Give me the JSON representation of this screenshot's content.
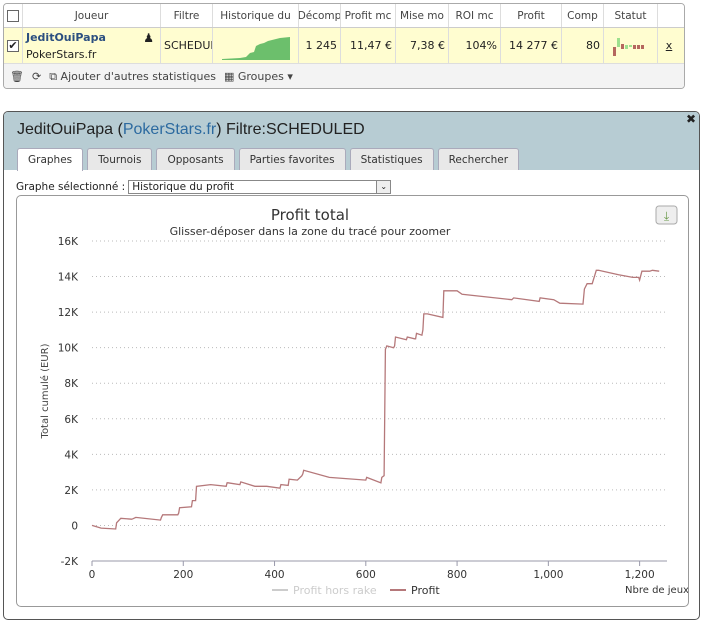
{
  "grid": {
    "headers": [
      "Joueur",
      "Filtre",
      "Historique du",
      "Décomp",
      "Profit mc",
      "Mise mo",
      "ROI mc",
      "Profit",
      "Comp",
      "Statut"
    ],
    "row": {
      "player": "JeditOuiPapa",
      "site": "PokerStars.fr",
      "filter": "SCHEDULED",
      "games": "1 245",
      "avg_profit": "11,47 €",
      "avg_stake": "7,38 €",
      "roi": "104%",
      "profit": "14 277 €",
      "comp": "80",
      "remove": "x"
    },
    "footer": {
      "add_stats": "Ajouter d'autres statistiques",
      "groups": "Groupes"
    }
  },
  "panel": {
    "title_player": "JeditOuiPapa",
    "title_open": " (",
    "title_site": "PokerStars.fr",
    "title_close": ")",
    "title_filter": " Filtre:SCHEDULED",
    "close": "✖",
    "tabs": [
      "Graphes",
      "Tournois",
      "Opposants",
      "Parties favorites",
      "Statistiques",
      "Rechercher"
    ],
    "select_label": "Graphe sélectionné :",
    "select_value": "Historique du profit"
  },
  "chart_data": {
    "type": "line",
    "title": "Profit total",
    "subtitle": "Glisser-déposer dans la zone du tracé pour zoomer",
    "xlabel": "Nbre de jeux",
    "ylabel": "Total cumulé (EUR)",
    "xlim": [
      0,
      1260
    ],
    "ylim": [
      -2000,
      16000
    ],
    "xticks": [
      0,
      200,
      400,
      600,
      800,
      1000,
      1200
    ],
    "xtick_labels": [
      "0",
      "200",
      "400",
      "600",
      "800",
      "1,000",
      "1,200"
    ],
    "yticks": [
      -2000,
      0,
      2000,
      4000,
      6000,
      8000,
      10000,
      12000,
      14000,
      16000
    ],
    "ytick_labels": [
      "-2K",
      "0",
      "2K",
      "4K",
      "6K",
      "8K",
      "10K",
      "12K",
      "14K",
      "16K"
    ],
    "grid": true,
    "legend": "bottom-center",
    "series": [
      {
        "name": "Profit hors rake",
        "visible": false,
        "color": "#cccccc",
        "x": [],
        "y": []
      },
      {
        "name": "Profit",
        "visible": true,
        "color": "#b5787a",
        "x": [
          0,
          20,
          52,
          54,
          63,
          87,
          90,
          96,
          150,
          152,
          155,
          188,
          190,
          192,
          218,
          220,
          227,
          229,
          260,
          294,
          296,
          298,
          324,
          326,
          357,
          383,
          412,
          414,
          430,
          432,
          450,
          460,
          462,
          464,
          520,
          600,
          602,
          633,
          635,
          640,
          643,
          646,
          661,
          663,
          665,
          689,
          691,
          707,
          709,
          711,
          723,
          725,
          727,
          735,
          769,
          771,
          800,
          811,
          920,
          924,
          980,
          982,
          1012,
          1025,
          1076,
          1079,
          1085,
          1096,
          1105,
          1110,
          1154,
          1185,
          1198,
          1200,
          1205,
          1222,
          1228,
          1243
        ],
        "y": [
          0,
          -150,
          -200,
          150,
          400,
          350,
          380,
          450,
          300,
          450,
          600,
          600,
          700,
          1000,
          1050,
          1400,
          1400,
          2200,
          2300,
          2200,
          2400,
          2400,
          2300,
          2450,
          2200,
          2200,
          2100,
          2300,
          2250,
          2600,
          2550,
          2800,
          2900,
          3100,
          2700,
          2550,
          2700,
          2400,
          2700,
          2800,
          9900,
          10100,
          10000,
          10100,
          10600,
          10450,
          10600,
          10500,
          10500,
          10800,
          10700,
          11000,
          11900,
          11900,
          11700,
          13200,
          13200,
          13000,
          12700,
          12800,
          12600,
          12800,
          12700,
          12500,
          12450,
          13300,
          13600,
          13600,
          14350,
          14350,
          14100,
          13950,
          13950,
          13800,
          14300,
          14300,
          14350,
          14300
        ]
      }
    ]
  },
  "colors": {
    "header": "#b7ccd3",
    "row_highlight": "#fffdd0",
    "link": "#2c6aa0",
    "line": "#b5787a",
    "spark": "#6cbf6c"
  }
}
